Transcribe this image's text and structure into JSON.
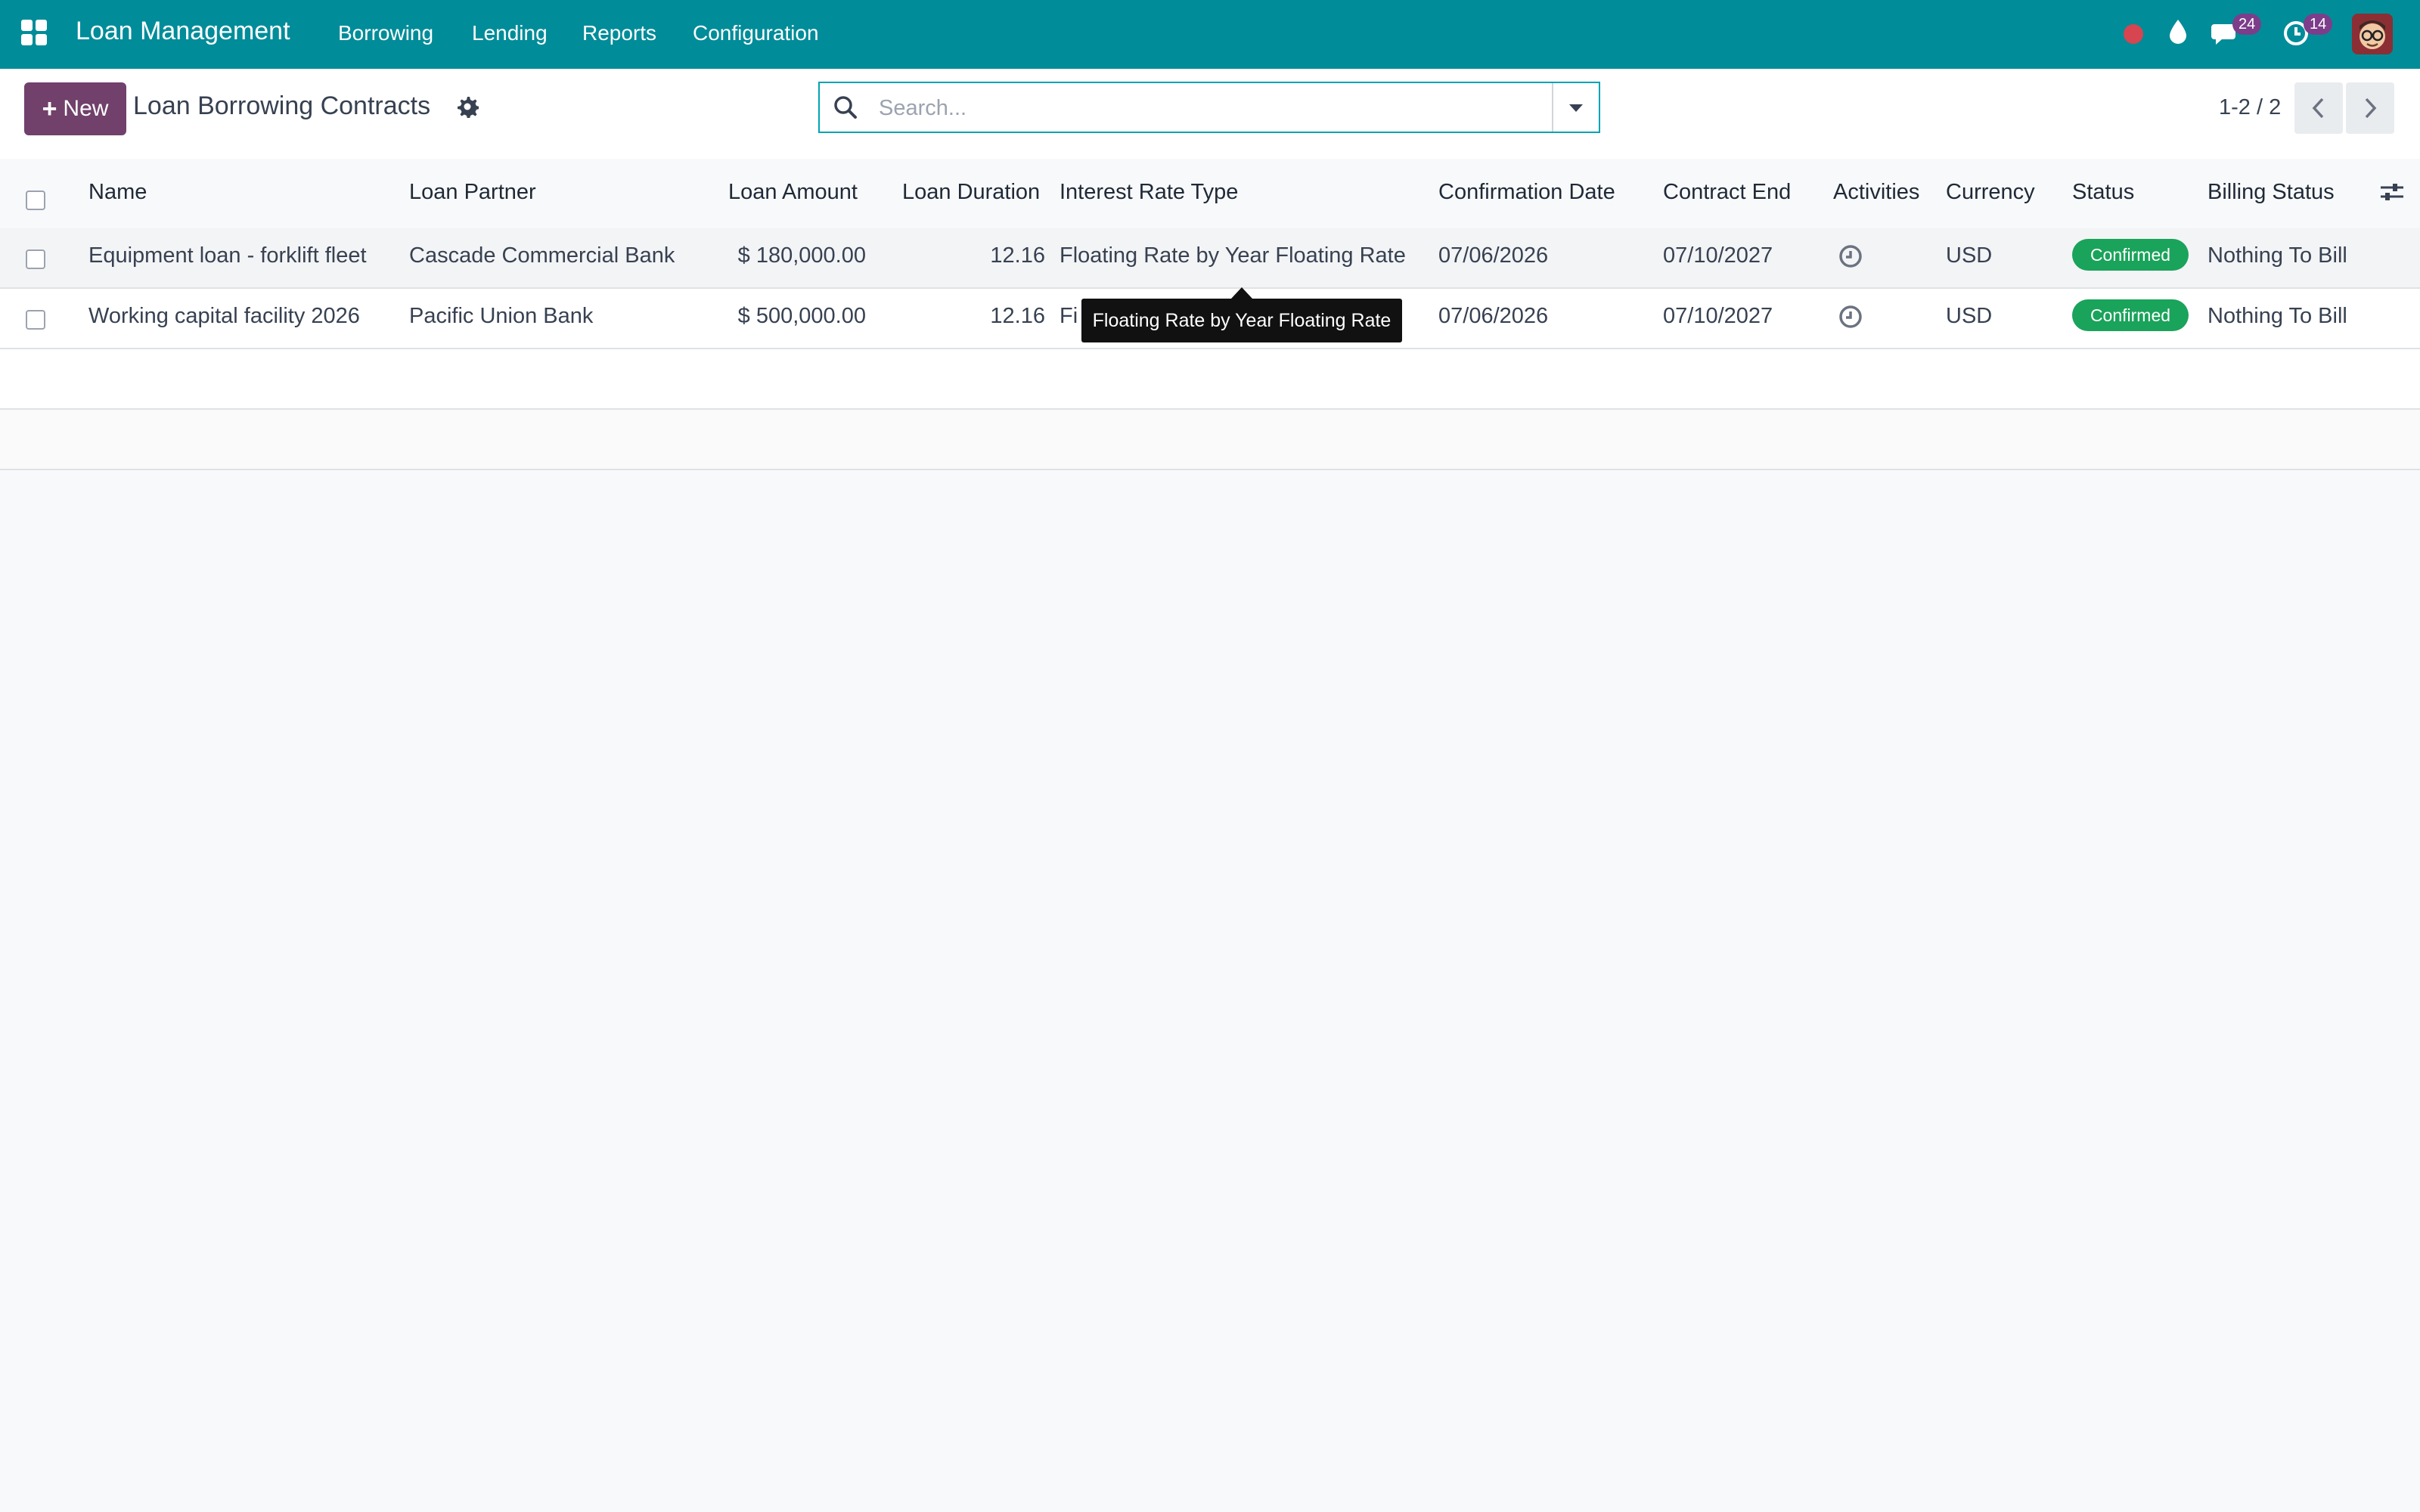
{
  "navbar": {
    "app_title": "Loan Management",
    "menu": [
      "Borrowing",
      "Lending",
      "Reports",
      "Configuration"
    ],
    "messages_count": "24",
    "activities_count": "14"
  },
  "control_panel": {
    "new_label": "New",
    "breadcrumb": "Loan Borrowing Contracts",
    "search_placeholder": "Search...",
    "pager": "1-2 / 2"
  },
  "table": {
    "columns": [
      "Name",
      "Loan Partner",
      "Loan Amount",
      "Loan Duration",
      "Interest Rate Type",
      "Confirmation Date",
      "Contract End",
      "Activities",
      "Currency",
      "Status",
      "Billing Status"
    ],
    "rows": [
      {
        "name": "Equipment loan - forklift fleet",
        "partner": "Cascade Commercial Bank",
        "amount": "$ 180,000.00",
        "duration": "12.16",
        "interest_type": "Floating Rate by Year Floating Rate",
        "confirmation_date": "07/06/2026",
        "contract_end": "07/10/2027",
        "currency": "USD",
        "status": "Confirmed",
        "billing_status": "Nothing To Bill"
      },
      {
        "name": "Working capital facility 2026",
        "partner": "Pacific Union Bank",
        "amount": "$ 500,000.00",
        "duration": "12.16",
        "interest_type": "Fi",
        "confirmation_date": "07/06/2026",
        "contract_end": "07/10/2027",
        "currency": "USD",
        "status": "Confirmed",
        "billing_status": "Nothing To Bill"
      }
    ]
  },
  "tooltip": "Floating Rate by Year Floating Rate",
  "colors": {
    "navbar": "#008c99",
    "primary_button": "#71406b",
    "status_confirmed": "#1aa35a",
    "badge": "#7c3e8a"
  }
}
